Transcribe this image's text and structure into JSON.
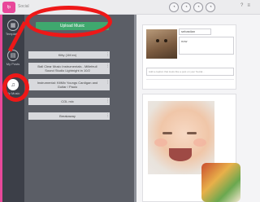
{
  "app": {
    "title": "Social",
    "logo_text": "fp"
  },
  "top_icons": [
    "◔",
    "◔",
    "◔",
    "◔"
  ],
  "top_right": [
    "?",
    "≡"
  ],
  "rail": {
    "items": [
      {
        "label": "Templates",
        "icon": "layout-icon",
        "glyph": "▦"
      },
      {
        "label": "My Posts",
        "icon": "posts-icon",
        "glyph": "▤"
      },
      {
        "label": "My Music",
        "icon": "music-icon",
        "glyph": "♫"
      }
    ]
  },
  "library": {
    "upload_label": "Upload Music",
    "items": [
      {
        "label": "Kitty (1M ex)"
      },
      {
        "label": "Ball Clear Music Instrumentals - Millefeuil Sound Studio Lightnight in 10/2"
      },
      {
        "label": "Instrumental: KitMix Youngs Cardigan and Guitar / Paulo"
      },
      {
        "label": "COL mix"
      },
      {
        "label": "Breakaway"
      }
    ]
  },
  "composer": {
    "name_value": "sebastian",
    "time_value": "now",
    "input_placeholder": "Add a caption that looks like a post on your Social..."
  },
  "photo_card": {
    "caption": ""
  }
}
